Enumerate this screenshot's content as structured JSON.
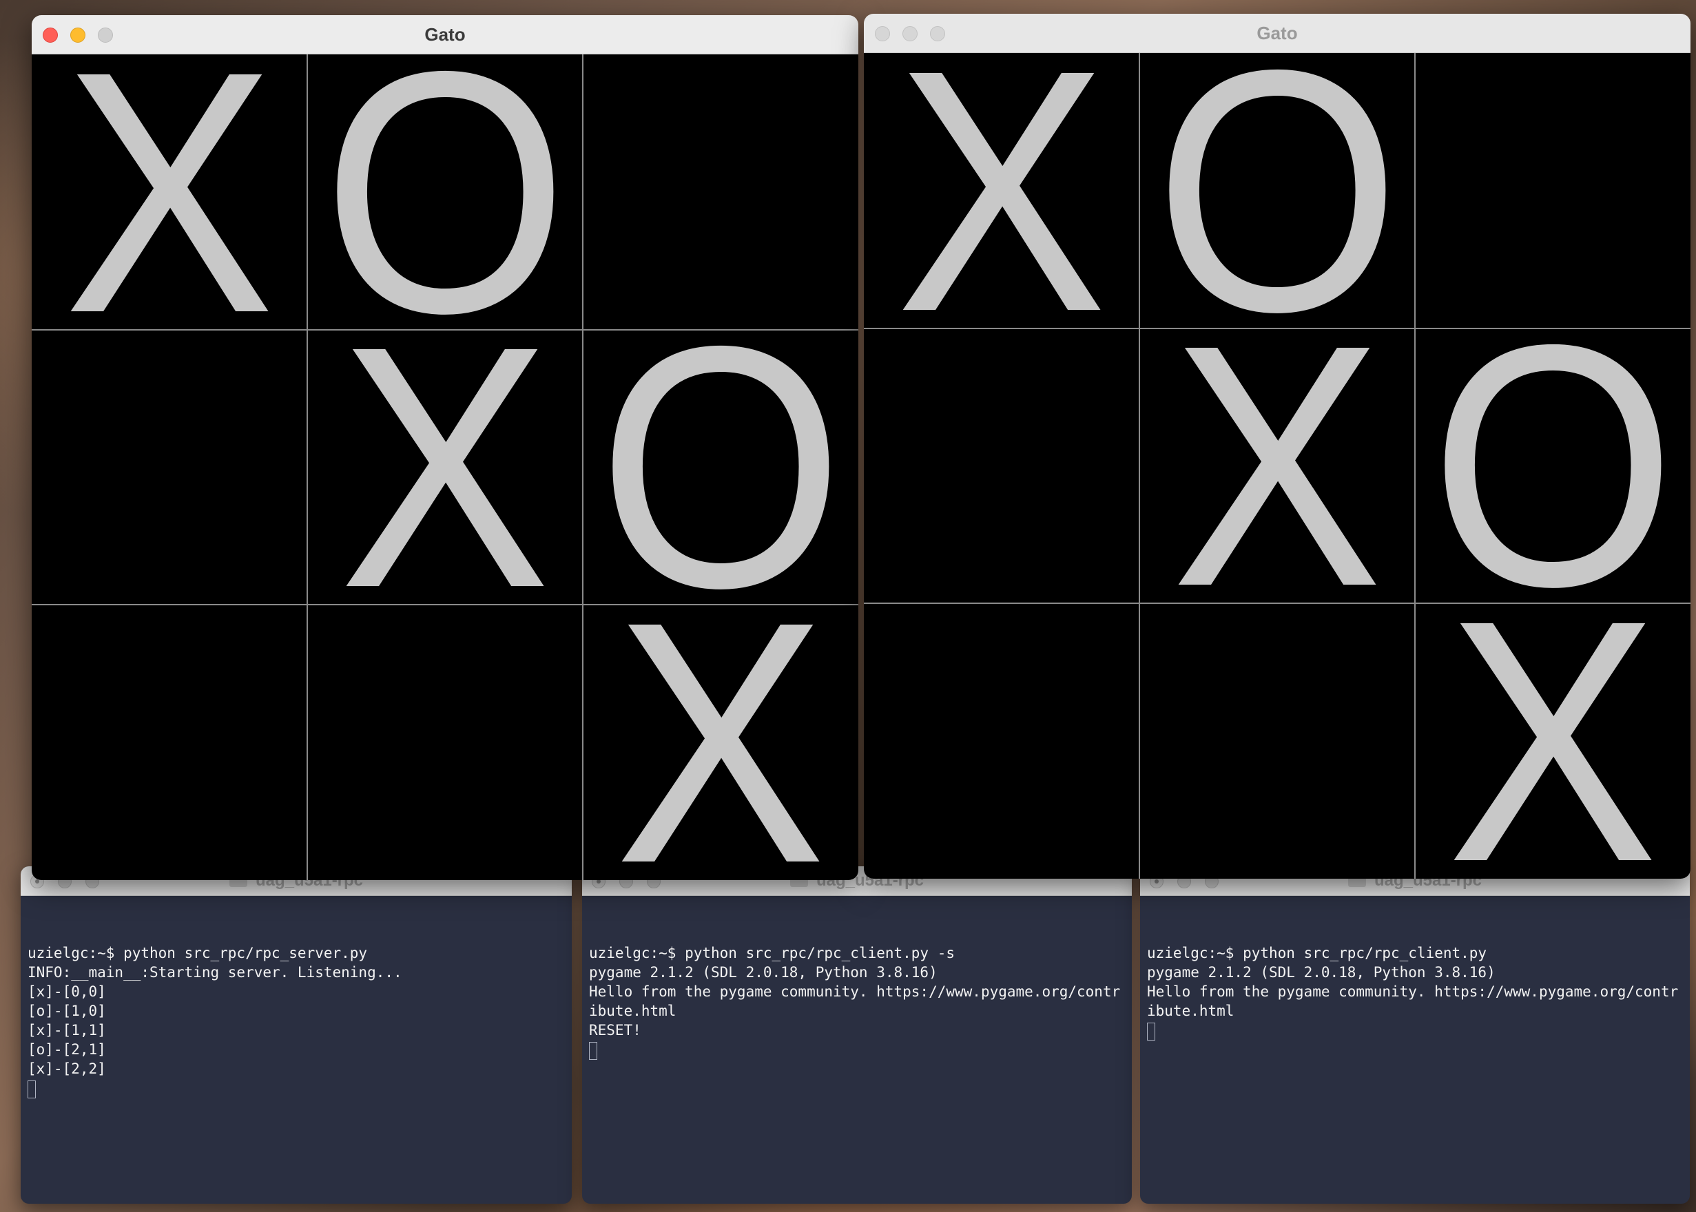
{
  "game_windows": [
    {
      "title": "Gato",
      "active": true,
      "board": [
        [
          "X",
          "O",
          ""
        ],
        [
          "",
          "X",
          "O"
        ],
        [
          "",
          "",
          "X"
        ]
      ]
    },
    {
      "title": "Gato",
      "active": false,
      "board": [
        [
          "X",
          "O",
          ""
        ],
        [
          "",
          "X",
          "O"
        ],
        [
          "",
          "",
          "X"
        ]
      ]
    }
  ],
  "terminals": [
    {
      "title": "uag_u5a1-rpc",
      "lines": [
        "uzielgc:~$ python src_rpc/rpc_server.py",
        "INFO:__main__:Starting server. Listening...",
        "[x]-[0,0]",
        "[o]-[1,0]",
        "[x]-[1,1]",
        "[o]-[2,1]",
        "[x]-[2,2]"
      ]
    },
    {
      "title": "uag_u5a1-rpc",
      "lines": [
        "uzielgc:~$ python src_rpc/rpc_client.py -s",
        "pygame 2.1.2 (SDL 2.0.18, Python 3.8.16)",
        "Hello from the pygame community. https://www.pygame.org/contribute.html",
        "RESET!"
      ]
    },
    {
      "title": "uag_u5a1-rpc",
      "lines": [
        "uzielgc:~$ python src_rpc/rpc_client.py",
        "pygame 2.1.2 (SDL 2.0.18, Python 3.8.16)",
        "Hello from the pygame community. https://www.pygame.org/contribute.html"
      ]
    }
  ],
  "colors": {
    "close": "#ff5f57",
    "minimize": "#febc2e",
    "zoom": "#d0d0d0",
    "board_bg": "#000000",
    "mark": "#c8c8c8",
    "terminal_bg": "#2a2f41"
  }
}
